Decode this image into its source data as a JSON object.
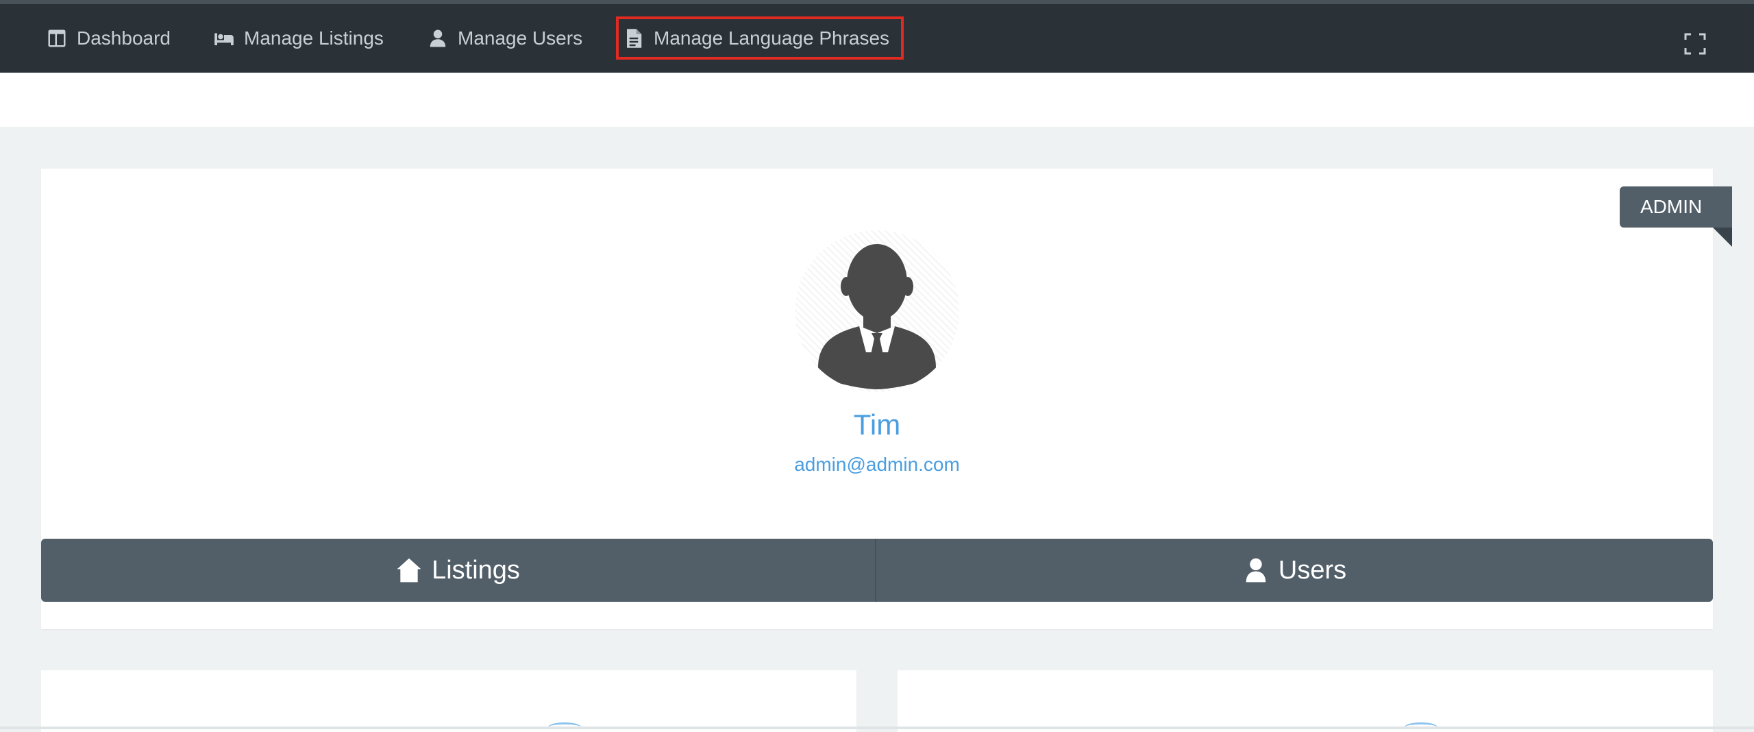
{
  "nav": {
    "items": [
      {
        "label": "Dashboard",
        "icon": "dashboard-icon"
      },
      {
        "label": "Manage Listings",
        "icon": "bed-icon"
      },
      {
        "label": "Manage Users",
        "icon": "user-icon"
      },
      {
        "label": "Manage Language Phrases",
        "icon": "document-icon"
      }
    ],
    "highlighted_item": "Manage Language Phrases",
    "fullscreen_icon": "fullscreen-icon"
  },
  "profile": {
    "badge": "ADMIN",
    "name": "Tim",
    "email": "admin@admin.com",
    "avatar_icon": "businessman-avatar-icon"
  },
  "tabs": [
    {
      "label": "Listings",
      "icon": "home-icon"
    },
    {
      "label": "Users",
      "icon": "user-icon"
    }
  ],
  "colors": {
    "topbar": "#2a3238",
    "accent_link": "#4a9ee0",
    "tab_bg": "#525f69",
    "highlight_box": "#e02a22",
    "page_bg": "#eef2f2"
  }
}
